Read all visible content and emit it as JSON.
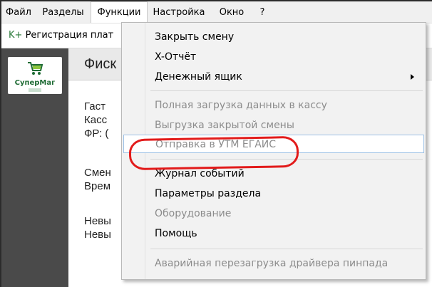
{
  "menubar": {
    "items": [
      "Файл",
      "Разделы",
      "Функции",
      "Настройка",
      "Окно",
      "?"
    ],
    "open_index": 2
  },
  "tab": {
    "prefix": "K+",
    "label": "Регистрация плат"
  },
  "sidebar": {
    "logo_text": "СуперМаг"
  },
  "main": {
    "title": "Фиск",
    "lines": [
      "Гаст",
      "Касс",
      "ФР: (",
      "Смен",
      "Врем",
      "Невы",
      "Невы"
    ]
  },
  "dropdown": {
    "items": [
      {
        "label": "Закрыть смену",
        "disabled": false
      },
      {
        "label": "X-Отчёт",
        "disabled": false
      },
      {
        "label": "Денежный ящик",
        "disabled": false,
        "submenu": true
      },
      {
        "label": "Полная загрузка данных в кассу",
        "disabled": true
      },
      {
        "label": "Выгрузка закрытой смены",
        "disabled": true
      },
      {
        "label": "Отправка в УТМ ЕГАИС",
        "disabled": true,
        "hovered": true
      },
      {
        "label": "Журнал событий",
        "disabled": false
      },
      {
        "label": "Параметры раздела",
        "disabled": false
      },
      {
        "label": "Оборудование",
        "disabled": true
      },
      {
        "label": "Помощь",
        "disabled": false
      },
      {
        "label": "Аварийная перезагрузка драйвера пинпада",
        "disabled": true
      }
    ]
  },
  "colors": {
    "highlight_oval": "#e21b1b",
    "hover_border": "#9dc1e6",
    "sidebar_bg": "#4a4a4a",
    "logo_green": "#1e6b34"
  }
}
